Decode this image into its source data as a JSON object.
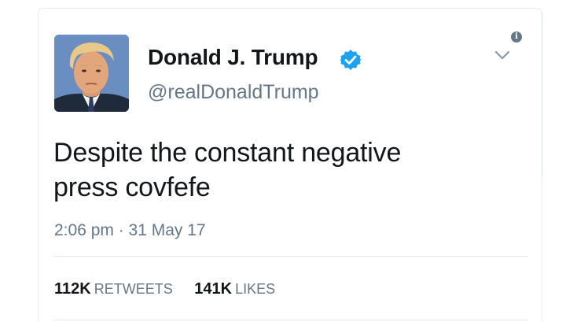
{
  "tweet": {
    "display_name": "Donald J. Trump",
    "handle": "@realDonaldTrump",
    "verified": true,
    "text_lines": [
      "Despite the constant negative",
      "press covfefe"
    ],
    "timestamp": "2:06 pm · 31 May 17",
    "stats": {
      "retweets_count": "112K",
      "retweets_label": "RETWEETS",
      "likes_count": "141K",
      "likes_label": "LIKES"
    }
  },
  "icons": {
    "info": "info-icon",
    "chevron": "chevron-down-icon",
    "verified": "verified-badge-icon",
    "avatar": "profile-photo"
  },
  "colors": {
    "verified_blue": "#1da1f2",
    "text_primary": "#14171a",
    "text_secondary": "#657786",
    "divider": "#e1e8ed"
  }
}
